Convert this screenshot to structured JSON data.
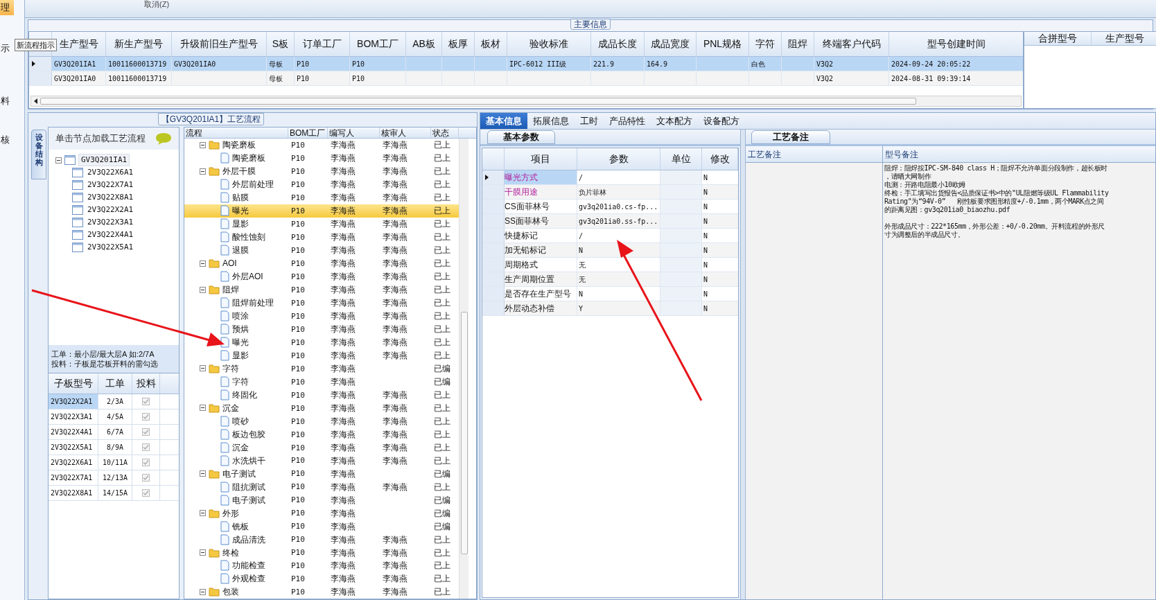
{
  "side_strip": {
    "items": [
      {
        "label": "理",
        "selected": true
      },
      {
        "label": "示",
        "selected": false
      },
      {
        "label": "料",
        "selected": false
      },
      {
        "label": "核",
        "selected": false
      }
    ]
  },
  "tooltip": "新流程指示",
  "toolbar": {
    "button": "取消(Z)"
  },
  "main_info": {
    "title": "主要信息",
    "columns": [
      "生产型号",
      "新生产型号",
      "升级前旧生产型号",
      "S板",
      "订单工厂",
      "BOM工厂",
      "AB板",
      "板厚",
      "板材",
      "验收标准",
      "成品长度",
      "成品宽度",
      "PNL规格",
      "字符",
      "阻焊",
      "终端客户代码",
      "型号创建时间"
    ],
    "rows": [
      {
        "selected": true,
        "cells": [
          "GV3Q201IA1",
          "10011600013719",
          "GV3Q201IA0",
          "母板",
          "P10",
          "P10",
          null,
          null,
          null,
          "IPC-6012 III级",
          "221.9",
          "164.9",
          null,
          "白色",
          null,
          "V3Q2",
          "2024-09-24 20:05:22"
        ]
      },
      {
        "selected": false,
        "cells": [
          "GV3Q201IA0",
          "10011600013719",
          null,
          "母板",
          "P10",
          "P10",
          null,
          null,
          null,
          null,
          null,
          null,
          null,
          null,
          null,
          "V3Q2",
          "2024-08-31 09:39:14"
        ]
      }
    ],
    "side_columns": [
      "合拼型号",
      "生产型号"
    ]
  },
  "flow_panel": {
    "title": "【GV3Q201IA1】工艺流程",
    "side_tab": "设备结构",
    "hint": "单击节点加载工艺流程",
    "tree": {
      "label": "GV3Q201IA1",
      "expanded": true,
      "children": [
        {
          "label": "2V3Q22X6A1"
        },
        {
          "label": "2V3Q22X7A1"
        },
        {
          "label": "2V3Q22X8A1"
        },
        {
          "label": "2V3Q22X2A1"
        },
        {
          "label": "2V3Q22X3A1"
        },
        {
          "label": "2V3Q22X4A1"
        },
        {
          "label": "2V3Q22X5A1"
        }
      ]
    },
    "notes": [
      "工单：最小层/最大层A 如:2/7A",
      "投料：子板是芯板开料的需勾选"
    ],
    "sub_boards": {
      "columns": [
        "子板型号",
        "工单",
        "投料"
      ],
      "rows": [
        {
          "model": "2V3Q22X2A1",
          "order": "2/3A",
          "checked": true,
          "selected": true
        },
        {
          "model": "2V3Q22X3A1",
          "order": "4/5A",
          "checked": true,
          "selected": false
        },
        {
          "model": "2V3Q22X4A1",
          "order": "6/7A",
          "checked": true,
          "selected": false
        },
        {
          "model": "2V3Q22X5A1",
          "order": "8/9A",
          "checked": true,
          "selected": false
        },
        {
          "model": "2V3Q22X6A1",
          "order": "10/11A",
          "checked": true,
          "selected": false
        },
        {
          "model": "2V3Q22X7A1",
          "order": "12/13A",
          "checked": true,
          "selected": false
        },
        {
          "model": "2V3Q22X8A1",
          "order": "14/15A",
          "checked": true,
          "selected": false
        }
      ]
    },
    "flow": {
      "columns": [
        "流程",
        "BOM工厂",
        "编写人",
        "核审人",
        "状态"
      ],
      "groups": [
        {
          "name": "陶瓷磨板",
          "bom": "P10",
          "writer": "李海燕",
          "reviewer": "李海燕",
          "status": "已上",
          "selected": false,
          "expanded": true,
          "children": [
            {
              "name": "陶瓷磨板",
              "bom": "P10",
              "writer": "李海燕",
              "reviewer": "李海燕",
              "status": "已上",
              "selected": false
            }
          ]
        },
        {
          "name": "外层干膜",
          "bom": "P10",
          "writer": "李海燕",
          "reviewer": "李海燕",
          "status": "已上",
          "selected": false,
          "expanded": true,
          "children": [
            {
              "name": "外层前处理",
              "bom": "P10",
              "writer": "李海燕",
              "reviewer": "李海燕",
              "status": "已上",
              "selected": false
            },
            {
              "name": "贴膜",
              "bom": "P10",
              "writer": "李海燕",
              "reviewer": "李海燕",
              "status": "已上",
              "selected": false
            },
            {
              "name": "曝光",
              "bom": "P10",
              "writer": "李海燕",
              "reviewer": "李海燕",
              "status": "已上",
              "selected": true
            },
            {
              "name": "显影",
              "bom": "P10",
              "writer": "李海燕",
              "reviewer": "李海燕",
              "status": "已上",
              "selected": false
            },
            {
              "name": "酸性蚀刻",
              "bom": "P10",
              "writer": "李海燕",
              "reviewer": "李海燕",
              "status": "已上",
              "selected": false
            },
            {
              "name": "退膜",
              "bom": "P10",
              "writer": "李海燕",
              "reviewer": "李海燕",
              "status": "已上",
              "selected": false
            }
          ]
        },
        {
          "name": "AOI",
          "bom": "P10",
          "writer": "李海燕",
          "reviewer": "李海燕",
          "status": "已上",
          "selected": false,
          "expanded": true,
          "children": [
            {
              "name": "外层AOI",
              "bom": "P10",
              "writer": "李海燕",
              "reviewer": "李海燕",
              "status": "已上",
              "selected": false
            }
          ]
        },
        {
          "name": "阻焊",
          "bom": "P10",
          "writer": "李海燕",
          "reviewer": "李海燕",
          "status": "已上",
          "selected": false,
          "expanded": true,
          "children": [
            {
              "name": "阻焊前处理",
              "bom": "P10",
              "writer": "李海燕",
              "reviewer": "李海燕",
              "status": "已上",
              "selected": false
            },
            {
              "name": "喷涂",
              "bom": "P10",
              "writer": "李海燕",
              "reviewer": "李海燕",
              "status": "已上",
              "selected": false
            },
            {
              "name": "预烘",
              "bom": "P10",
              "writer": "李海燕",
              "reviewer": "李海燕",
              "status": "已上",
              "selected": false
            },
            {
              "name": "曝光",
              "bom": "P10",
              "writer": "李海燕",
              "reviewer": "李海燕",
              "status": "已上",
              "selected": false
            },
            {
              "name": "显影",
              "bom": "P10",
              "writer": "李海燕",
              "reviewer": "李海燕",
              "status": "已上",
              "selected": false
            }
          ]
        },
        {
          "name": "字符",
          "bom": "P10",
          "writer": "李海燕",
          "status": "已编",
          "selected": false,
          "expanded": true,
          "children": [
            {
              "name": "字符",
              "bom": "P10",
              "writer": "李海燕",
              "status": "已编",
              "selected": false
            },
            {
              "name": "终固化",
              "bom": "P10",
              "writer": "李海燕",
              "reviewer": "李海燕",
              "status": "已上",
              "selected": false
            }
          ]
        },
        {
          "name": "沉金",
          "bom": "P10",
          "writer": "李海燕",
          "reviewer": "李海燕",
          "status": "已上",
          "selected": false,
          "expanded": true,
          "children": [
            {
              "name": "喷砂",
              "bom": "P10",
              "writer": "李海燕",
              "reviewer": "李海燕",
              "status": "已上",
              "selected": false
            },
            {
              "name": "板边包胶",
              "bom": "P10",
              "writer": "李海燕",
              "reviewer": "李海燕",
              "status": "已上",
              "selected": false
            },
            {
              "name": "沉金",
              "bom": "P10",
              "writer": "李海燕",
              "reviewer": "李海燕",
              "status": "已上",
              "selected": false
            },
            {
              "name": "水洗烘干",
              "bom": "P10",
              "writer": "李海燕",
              "reviewer": "李海燕",
              "status": "已上",
              "selected": false
            }
          ]
        },
        {
          "name": "电子测试",
          "bom": "P10",
          "writer": "李海燕",
          "status": "已编",
          "selected": false,
          "expanded": true,
          "children": [
            {
              "name": "阻抗测试",
              "bom": "P10",
              "writer": "李海燕",
              "reviewer": "李海燕",
              "status": "已上",
              "selected": false
            },
            {
              "name": "电子测试",
              "bom": "P10",
              "writer": "李海燕",
              "status": "已编",
              "selected": false
            }
          ]
        },
        {
          "name": "外形",
          "bom": "P10",
          "writer": "李海燕",
          "status": "已编",
          "selected": false,
          "expanded": true,
          "children": [
            {
              "name": "铣板",
              "bom": "P10",
              "writer": "李海燕",
              "status": "已编",
              "selected": false
            },
            {
              "name": "成品清洗",
              "bom": "P10",
              "writer": "李海燕",
              "reviewer": "李海燕",
              "status": "已上",
              "selected": false
            }
          ]
        },
        {
          "name": "终检",
          "bom": "P10",
          "writer": "李海燕",
          "reviewer": "李海燕",
          "status": "已上",
          "selected": false,
          "expanded": true,
          "children": [
            {
              "name": "功能检查",
              "bom": "P10",
              "writer": "李海燕",
              "reviewer": "李海燕",
              "status": "已上",
              "selected": false
            },
            {
              "name": "外观检查",
              "bom": "P10",
              "writer": "李海燕",
              "reviewer": "李海燕",
              "status": "已上",
              "selected": false
            }
          ]
        },
        {
          "name": "包装",
          "bom": "P10",
          "writer": "李海燕",
          "reviewer": "李海燕",
          "status": "已上",
          "selected": false,
          "expanded": true
        }
      ]
    }
  },
  "detail_panel": {
    "tabs": [
      {
        "label": "基本信息",
        "selected": true
      },
      {
        "label": "拓展信息",
        "selected": false
      },
      {
        "label": "工时",
        "selected": false
      },
      {
        "label": "产品特性",
        "selected": false
      },
      {
        "label": "文本配方",
        "selected": false
      },
      {
        "label": "设备配方",
        "selected": false
      }
    ],
    "params": {
      "title": "基本参数",
      "columns": [
        "项目",
        "参数",
        "单位",
        "修改"
      ],
      "rows": [
        {
          "item": "曝光方式",
          "value": "/",
          "modified": "N",
          "highlighted": true,
          "selected": true
        },
        {
          "item": "干膜用途",
          "value": "负片菲林",
          "modified": "N",
          "highlighted": true,
          "selected": false
        },
        {
          "item": "CS面菲林号",
          "value": "gv3q201ia0.cs-fp...",
          "modified": "N",
          "highlighted": false,
          "selected": false
        },
        {
          "item": "SS面菲林号",
          "value": "gv3q201ia0.ss-fp...",
          "modified": "N",
          "highlighted": false,
          "selected": false
        },
        {
          "item": "快捷标记",
          "value": "/",
          "modified": "N",
          "highlighted": false,
          "selected": false
        },
        {
          "item": "加无铅标记",
          "value": "N",
          "modified": "N",
          "highlighted": false,
          "selected": false
        },
        {
          "item": "周期格式",
          "value": "无",
          "modified": "N",
          "highlighted": false,
          "selected": false
        },
        {
          "item": "生产周期位置",
          "value": "无",
          "modified": "N",
          "highlighted": false,
          "selected": false
        },
        {
          "item": "是否存在生产型号",
          "value": "N",
          "modified": "N",
          "highlighted": false,
          "selected": false
        },
        {
          "item": "外层动态补偿",
          "value": "Y",
          "modified": "N",
          "highlighted": false,
          "selected": false
        }
      ]
    },
    "remarks": {
      "title": "工艺备注",
      "columns": [
        "工艺备注",
        "型号备注"
      ],
      "paragraphs": [
        [
          "阻焊：阻焊按IPC-SM-840 class H；阻焊不允许单面分段制作，超长板时",
          "，请晒大网制作",
          "电测：开路电阻最小10欧姆",
          "终检：手工填写出货报告<品质保证书>中的\"UL阻燃等级UL Flammability",
          "Rating\"为“94V-0”   刚性板要求图形精度+/-0.1mm，两个MARK点之间",
          "的距离见图：gv3q201ia0_biaozhu.pdf"
        ],
        [
          "外形成品尺寸：222*165mm，外形公差：+0/-0.20mm。开料流程的外形尺",
          "寸为调整后的半成品尺寸。"
        ]
      ]
    }
  }
}
